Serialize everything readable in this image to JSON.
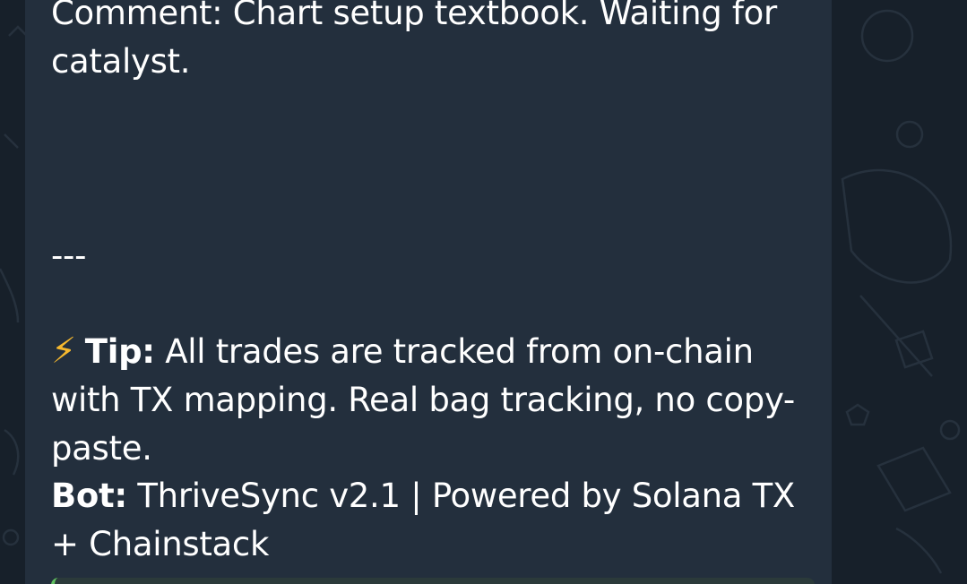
{
  "message": {
    "comment_text": "Comment: Chart setup textbook. Waiting for catalyst.",
    "divider": "---",
    "tip": {
      "icon": "lightning-icon",
      "label": "Tip:",
      "text": " All trades are tracked from on-chain with TX mapping. Real bag tracking, no copy-paste."
    },
    "bot": {
      "label": "Bot:",
      "text": " ThriveSync v2.1 | Powered by Solana TX + Chainstack"
    }
  },
  "colors": {
    "background": "#17202a",
    "bubble": "#232f3d",
    "text": "#ffffff",
    "accent_bolt": "#f5b82e",
    "reply_bar": "#5fbf5f"
  }
}
